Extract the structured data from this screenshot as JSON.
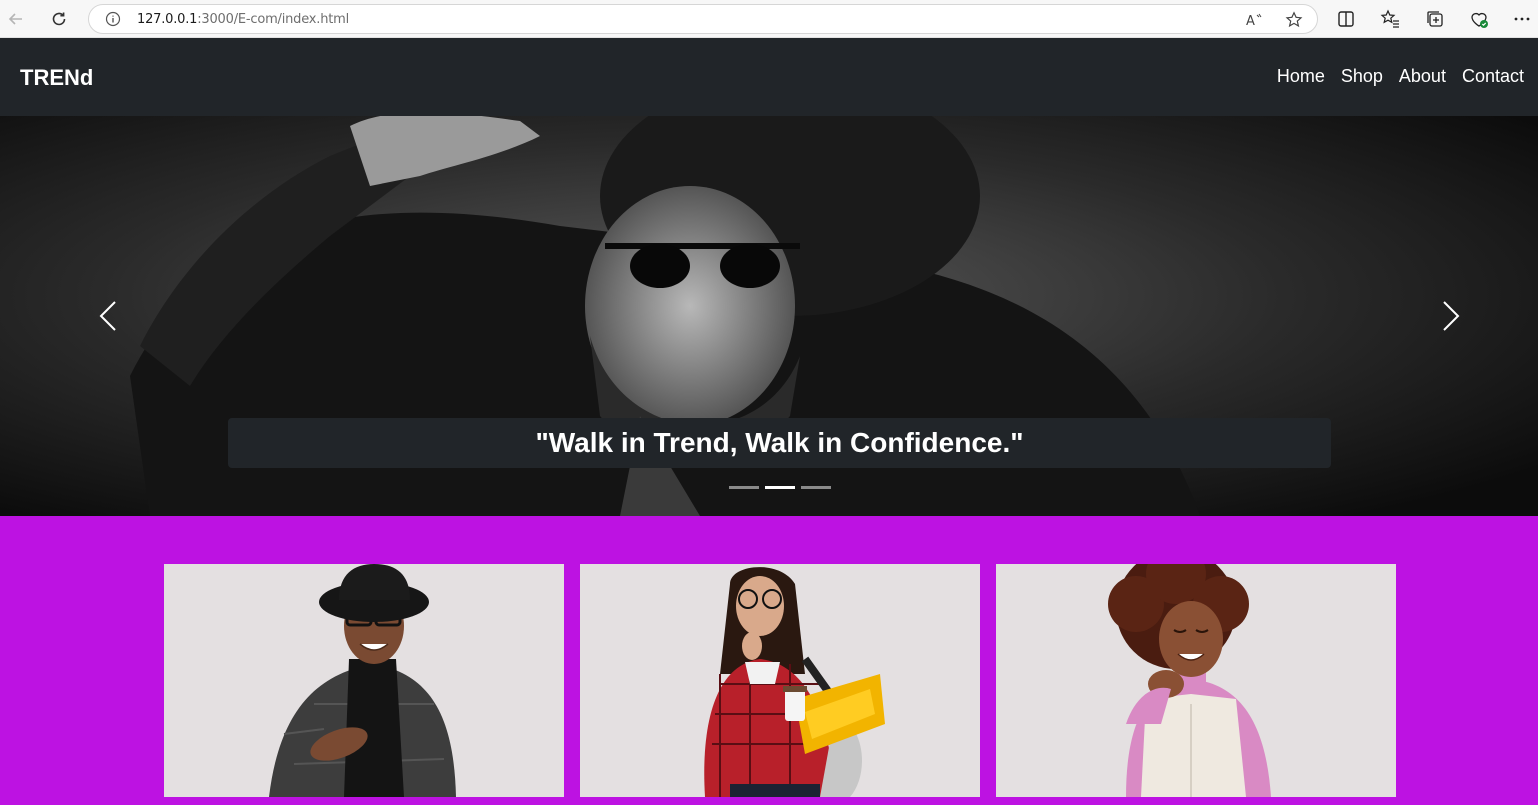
{
  "browser": {
    "url_host": "127.0.0.1",
    "url_rest": ":3000/E-com/index.html"
  },
  "navbar": {
    "brand": "TRENd",
    "links": [
      "Home",
      "Shop",
      "About",
      "Contact"
    ]
  },
  "hero": {
    "caption": "\"Walk in Trend, Walk in Confidence.\"",
    "slide_count": 3,
    "active_slide": 1
  },
  "cards": [
    {
      "image": "man-in-hat-and-glasses"
    },
    {
      "image": "woman-with-glasses-and-folders"
    },
    {
      "image": "woman-with-curly-hair"
    }
  ],
  "colors": {
    "navbar": "#212529",
    "accent": "#bd12e2",
    "card_bg": "#e4e0e1"
  }
}
